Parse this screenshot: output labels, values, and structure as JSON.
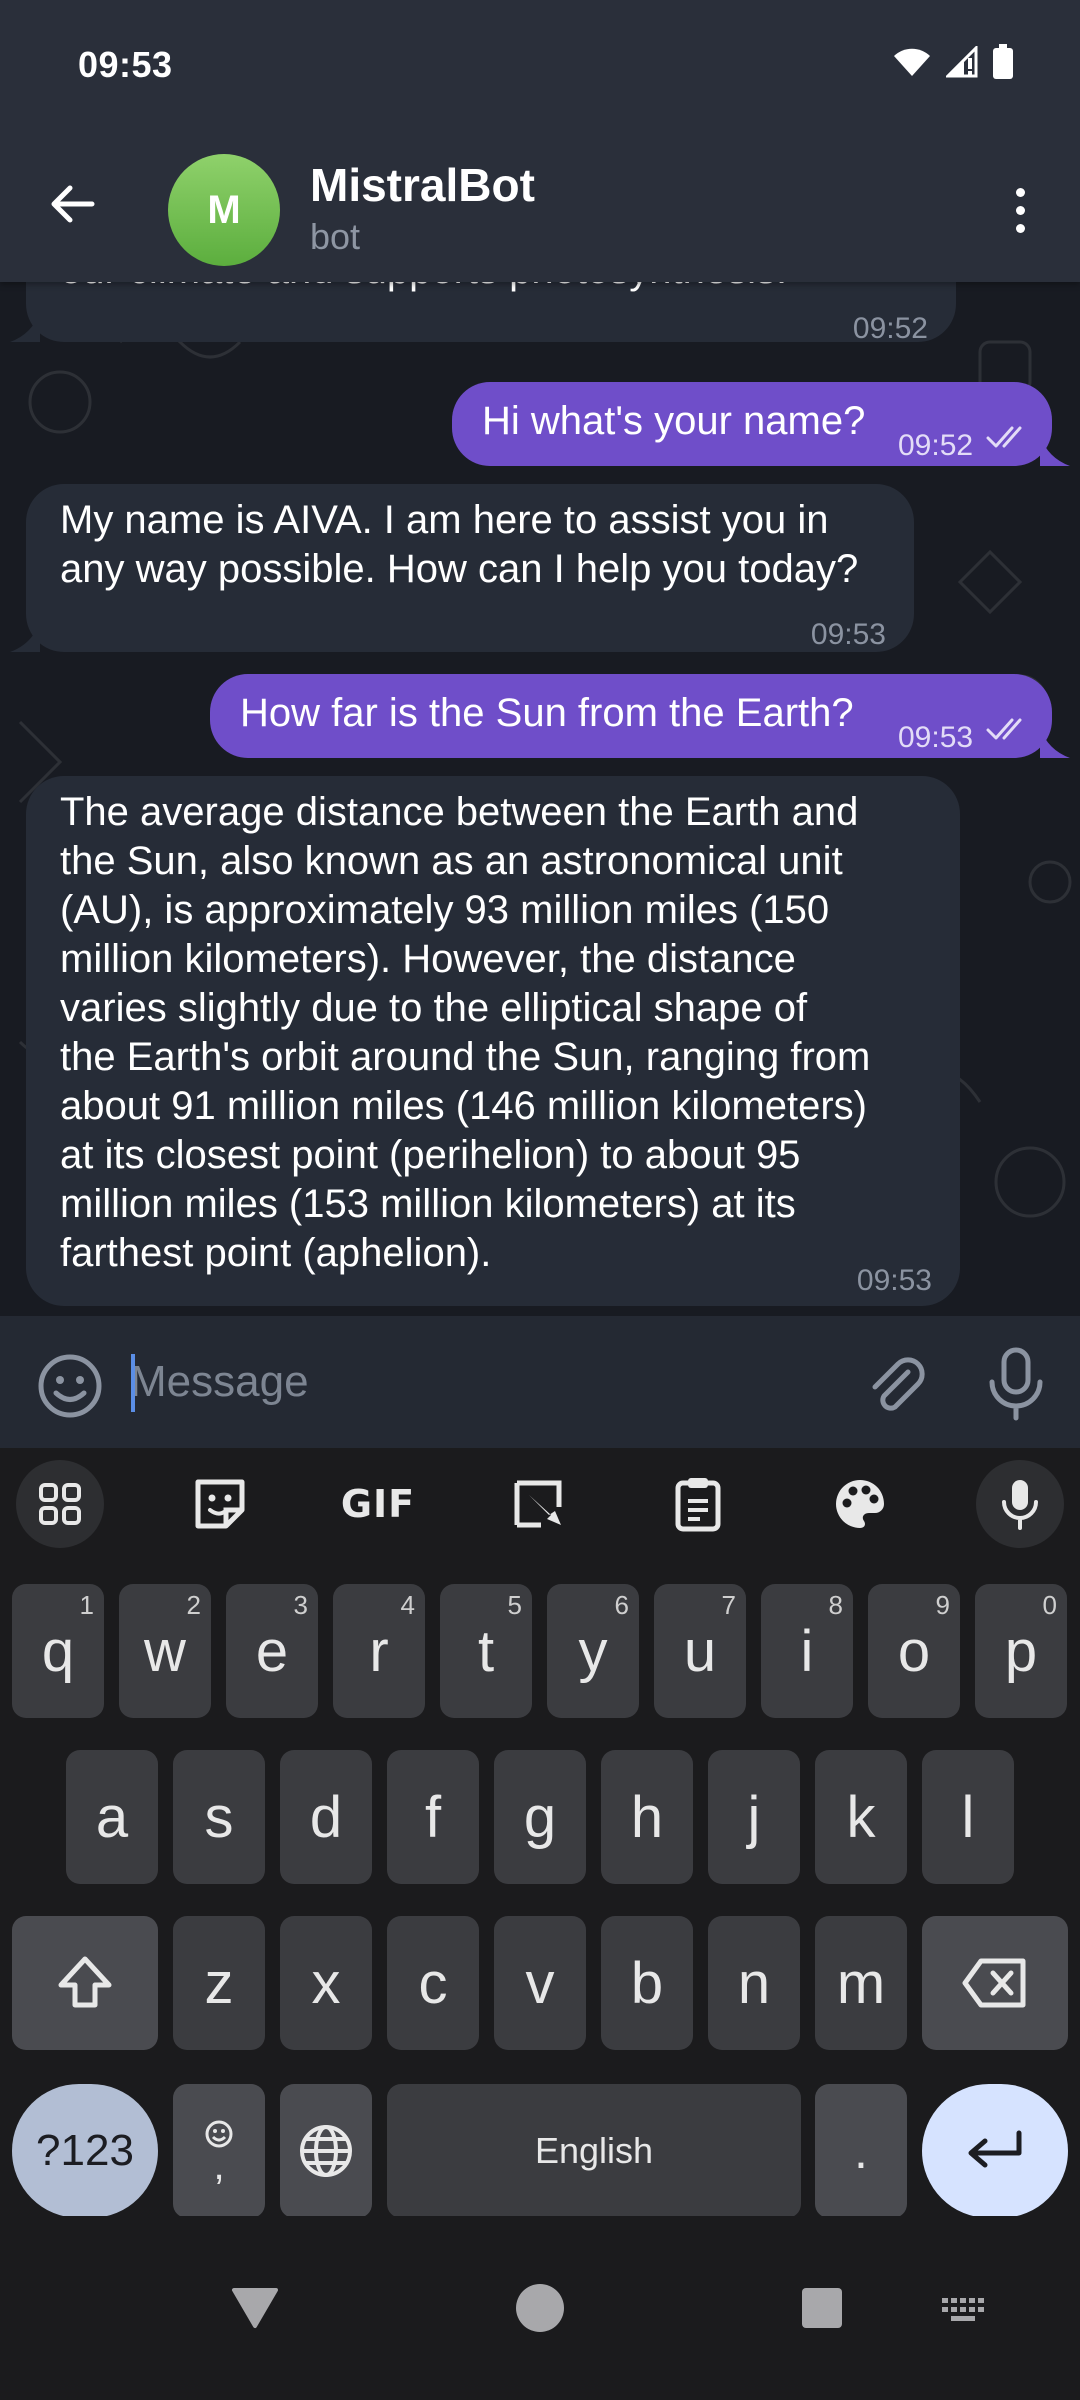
{
  "status_bar": {
    "time": "09:53"
  },
  "header": {
    "avatar_letter": "M",
    "title": "MistralBot",
    "subtitle": "bot",
    "avatar_color": "#6cbd4a"
  },
  "messages": [
    {
      "direction": "incoming",
      "text": "our climate and supports photosynthesis.",
      "time": "09:52"
    },
    {
      "direction": "outgoing",
      "text": "Hi what's your name?",
      "time": "09:52"
    },
    {
      "direction": "incoming",
      "text_lines": [
        "My name is AIVA. I am here to assist you in",
        "any way possible. How can I help you today?"
      ],
      "time": "09:53"
    },
    {
      "direction": "outgoing",
      "text": "How far is the Sun from the Earth?",
      "time": "09:53"
    },
    {
      "direction": "incoming",
      "text_lines": [
        "The average distance between the Earth and",
        "the Sun, also known as an astronomical unit",
        "(AU), is approximately 93 million miles (150",
        "million kilometers). However, the distance",
        "varies slightly due to the elliptical shape of",
        "the Earth's orbit around the Sun, ranging from",
        "about 91 million miles (146 million kilometers)",
        "at its closest point (perihelion) to about 95",
        "million miles (153 million kilometers) at its",
        "farthest point (aphelion)."
      ],
      "time": "09:53"
    }
  ],
  "composer": {
    "placeholder": "Message"
  },
  "keyboard": {
    "toolbar": [
      "apps-grid-icon",
      "sticker-icon",
      "GIF",
      "clipboard-edit-icon",
      "clipboard-icon",
      "palette-icon",
      "mic-icon"
    ],
    "gif_label": "GIF",
    "row1": [
      {
        "key": "q",
        "hint": "1"
      },
      {
        "key": "w",
        "hint": "2"
      },
      {
        "key": "e",
        "hint": "3"
      },
      {
        "key": "r",
        "hint": "4"
      },
      {
        "key": "t",
        "hint": "5"
      },
      {
        "key": "y",
        "hint": "6"
      },
      {
        "key": "u",
        "hint": "7"
      },
      {
        "key": "i",
        "hint": "8"
      },
      {
        "key": "o",
        "hint": "9"
      },
      {
        "key": "p",
        "hint": "0"
      }
    ],
    "row2": [
      "a",
      "s",
      "d",
      "f",
      "g",
      "h",
      "j",
      "k",
      "l"
    ],
    "row3": [
      "z",
      "x",
      "c",
      "v",
      "b",
      "n",
      "m"
    ],
    "symbols_label": "?123",
    "comma_label": ",",
    "space_label": "English",
    "period_label": "."
  },
  "colors": {
    "outgoing_bubble": "#6f4ec9",
    "incoming_bubble": "#262c37",
    "header": "#2a2f3a"
  }
}
